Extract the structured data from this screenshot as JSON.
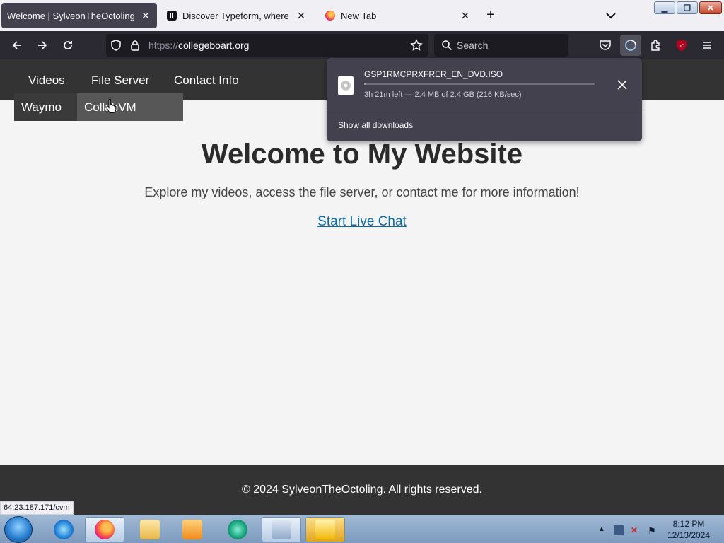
{
  "tabs": [
    {
      "title": "Welcome | SylveonTheOctoling",
      "active": true
    },
    {
      "title": "Discover Typeform, where forms",
      "active": false
    },
    {
      "title": "New Tab",
      "active": false
    }
  ],
  "toolbar": {
    "url_scheme": "https://",
    "url_host": "collegeboart.org",
    "search_placeholder": "Search"
  },
  "site": {
    "nav": [
      "Videos",
      "File Server",
      "Contact Info"
    ],
    "dropdown": [
      "Waymo",
      "CollabVM"
    ],
    "heading": "Welcome to My Website",
    "intro": "Explore my videos, access the file server, or contact me for more information!",
    "chat_link": "Start Live Chat",
    "footer": "© 2024 SylveonTheOctoling. All rights reserved."
  },
  "downloads": {
    "filename": "GSP1RMCPRXFRER_EN_DVD.ISO",
    "status": "3h 21m left — 2.4 MB of 2.4 GB (216 KB/sec)",
    "progress": 0.001,
    "show_all": "Show all downloads"
  },
  "statusbar": {
    "link": "64.23.187.171/cvm"
  },
  "taskbar": {
    "time": "8:12 PM",
    "date": "12/13/2024"
  },
  "colors": {
    "page_nav": "#333333",
    "link": "#0a6aa8",
    "browser_dark": "#2b2a33"
  }
}
